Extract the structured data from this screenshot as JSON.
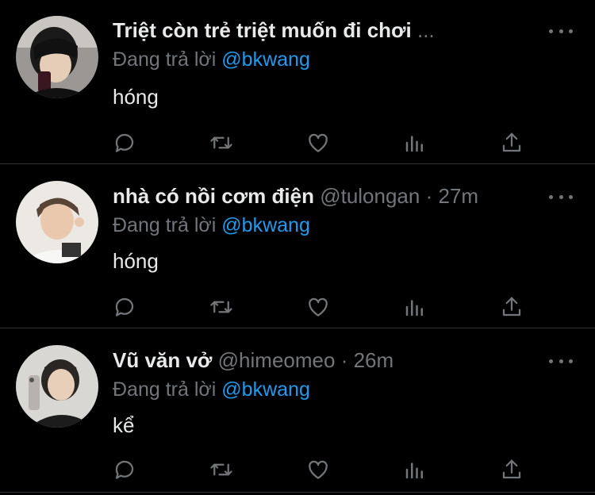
{
  "icons": {
    "more": "more-horizontal-icon",
    "reply": "reply-icon",
    "retweet": "retweet-icon",
    "like": "like-icon",
    "views": "views-icon",
    "share": "share-icon"
  },
  "colors": {
    "background": "#000000",
    "text": "#e7e9ea",
    "muted": "#71767b",
    "link": "#1d9bf0",
    "divider": "#2f3336"
  },
  "tweets": [
    {
      "name": "Triệt còn trẻ triệt muốn đi chơi",
      "name_overflow": "...",
      "handle": "",
      "separator": "",
      "time": "",
      "replying_prefix": "Đang trả lời",
      "replying_to": "@bkwang",
      "text": "hóng"
    },
    {
      "name": "nhà có nồi cơm điện",
      "name_overflow": "",
      "handle": "@tulongan",
      "separator": "·",
      "time": "27m",
      "replying_prefix": "Đang trả lời",
      "replying_to": "@bkwang",
      "text": "hóng"
    },
    {
      "name": "Vũ văn vở",
      "name_overflow": "",
      "handle": "@himeomeo",
      "separator": "·",
      "time": "26m",
      "replying_prefix": "Đang trả lời",
      "replying_to": "@bkwang",
      "text": "kể"
    }
  ]
}
